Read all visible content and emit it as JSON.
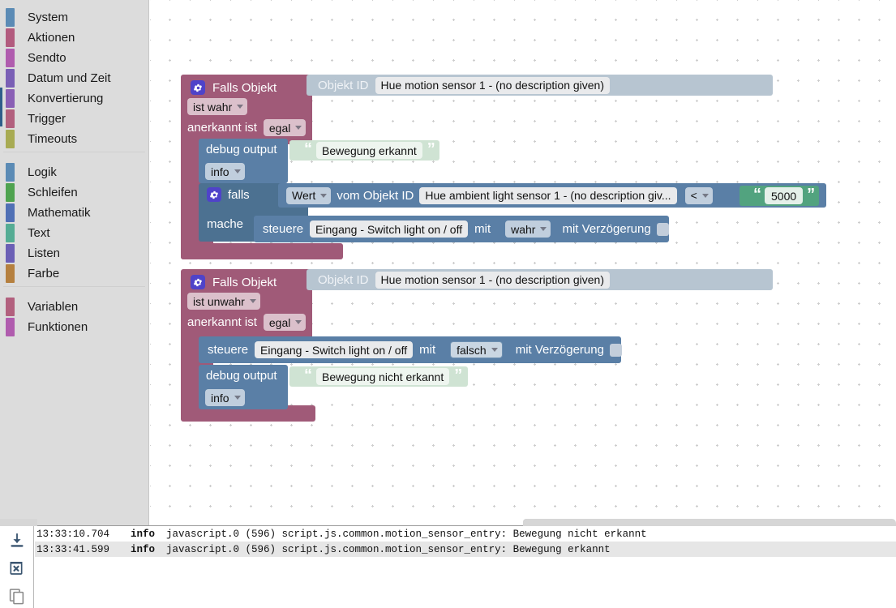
{
  "toolbox": {
    "groups": [
      {
        "items": [
          {
            "label": "System",
            "color": "#5b8bb5"
          },
          {
            "label": "Aktionen",
            "color": "#b25b7e"
          },
          {
            "label": "Sendto",
            "color": "#b05cae"
          },
          {
            "label": "Datum und Zeit",
            "color": "#7a5fb5"
          },
          {
            "label": "Konvertierung",
            "color": "#8a5fb5"
          },
          {
            "label": "Trigger",
            "color": "#b2607e"
          },
          {
            "label": "Timeouts",
            "color": "#a8ab53"
          }
        ]
      },
      {
        "items": [
          {
            "label": "Logik",
            "color": "#5b8bb5"
          },
          {
            "label": "Schleifen",
            "color": "#4fa350"
          },
          {
            "label": "Mathematik",
            "color": "#5070b5"
          },
          {
            "label": "Text",
            "color": "#55ac94"
          },
          {
            "label": "Listen",
            "color": "#6b5fb5"
          },
          {
            "label": "Farbe",
            "color": "#b5803f"
          }
        ]
      },
      {
        "items": [
          {
            "label": "Variablen",
            "color": "#b2607e"
          },
          {
            "label": "Funktionen",
            "color": "#b05cae"
          }
        ]
      }
    ]
  },
  "workspace": {
    "block1": {
      "title": "Falls Objekt",
      "gear_icon": "gear-icon",
      "condition_dropdown": "ist wahr",
      "ack_label": "anerkannt ist",
      "ack_dropdown": "egal",
      "objid_label": "Objekt ID",
      "objid_value": "Hue motion sensor 1 - (no description given)",
      "debug": {
        "label": "debug output",
        "level_dropdown": "info",
        "text_value": "Bewegung erkannt"
      },
      "inner_if": {
        "title": "falls",
        "do_label": "mache",
        "value_dropdown": "Wert",
        "from_label": "vom Objekt ID",
        "objid_value": "Hue ambient light sensor 1 - (no description giv...",
        "operator_dropdown": "<",
        "compare_value": "5000",
        "control": {
          "label": "steuere",
          "target": "Eingang - Switch light on / off",
          "with_label": "mit",
          "value_dropdown": "wahr",
          "delay_label": "mit Verzögerung",
          "delay_checked": false
        }
      }
    },
    "block2": {
      "title": "Falls Objekt",
      "gear_icon": "gear-icon",
      "condition_dropdown": "ist unwahr",
      "ack_label": "anerkannt ist",
      "ack_dropdown": "egal",
      "objid_label": "Objekt ID",
      "objid_value": "Hue motion sensor 1 - (no description given)",
      "control": {
        "label": "steuere",
        "target": "Eingang - Switch light on / off",
        "with_label": "mit",
        "value_dropdown": "falsch",
        "delay_label": "mit Verzögerung",
        "delay_checked": false
      },
      "debug": {
        "label": "debug output",
        "level_dropdown": "info",
        "text_value": "Bewegung nicht erkannt"
      }
    }
  },
  "log": {
    "tools": [
      {
        "name": "scroll-to-bottom-icon",
        "title": "scroll to bottom"
      },
      {
        "name": "delete-icon",
        "title": "clear log"
      },
      {
        "name": "copy-icon",
        "title": "copy log"
      }
    ],
    "rows": [
      {
        "timestamp": "13:33:10.704",
        "severity": "info",
        "message": "javascript.0 (596) script.js.common.motion_sensor_entry: Bewegung nicht erkannt"
      },
      {
        "timestamp": "13:33:41.599",
        "severity": "info",
        "message": "javascript.0 (596) script.js.common.motion_sensor_entry: Bewegung erkannt"
      }
    ]
  },
  "colors": {
    "control_block": "#a05a78",
    "action_block": "#5a7fa6",
    "objid_block": "#b7c5d1",
    "text_block": "#cfe3d3",
    "math_block": "#52a37f",
    "gear_badge": "#4f43c9",
    "toolbox_bg": "#dcdcdc"
  }
}
